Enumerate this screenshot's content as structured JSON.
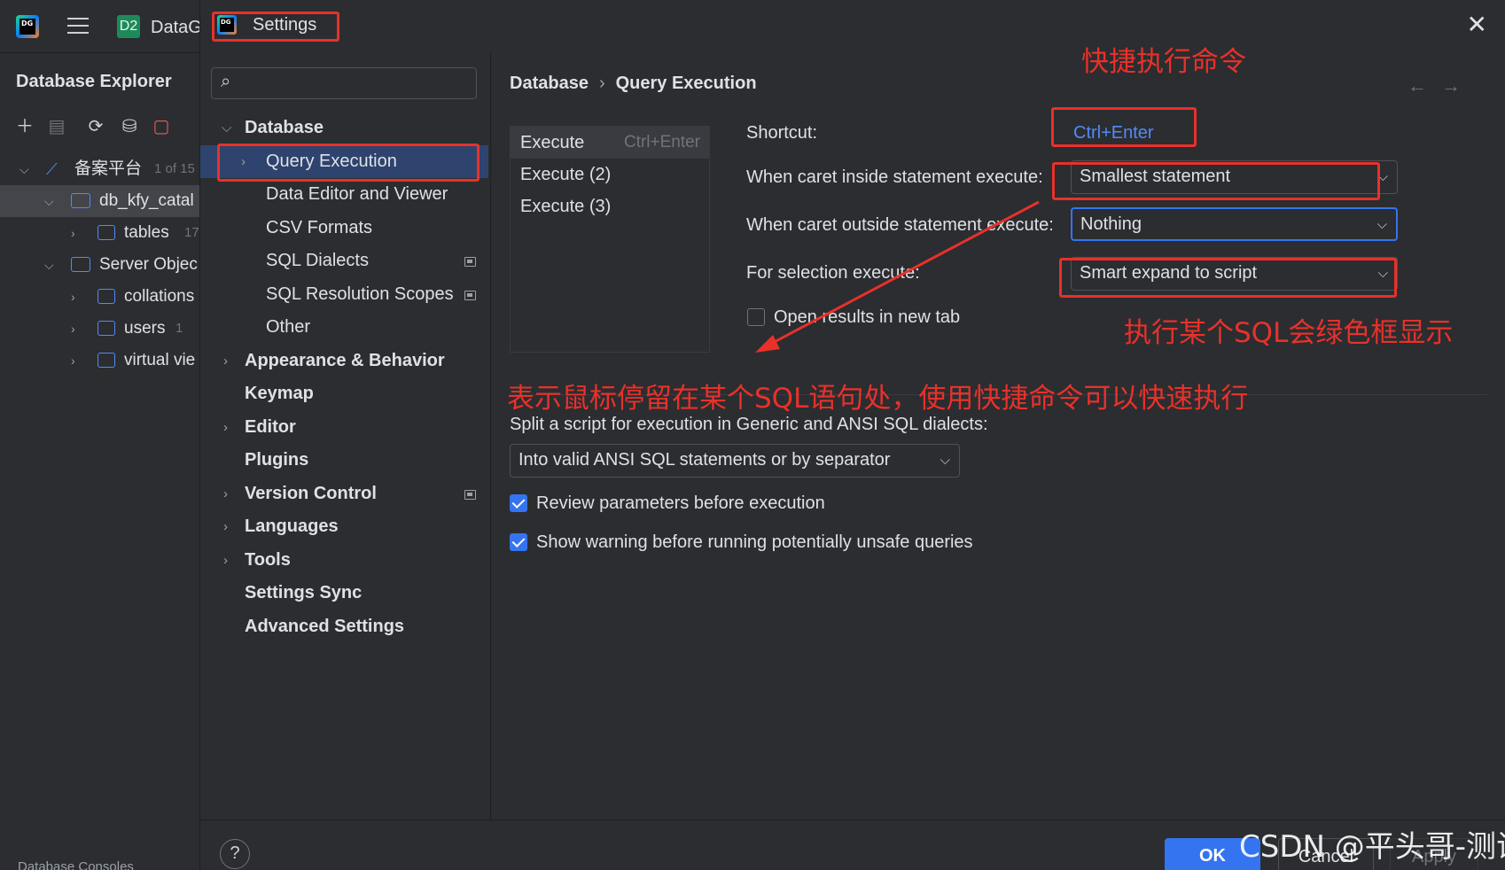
{
  "ide": {
    "logo_text": "DG",
    "project_badge": "D2",
    "project_name": "DataG",
    "explorer_title": "Database Explorer",
    "tree": [
      {
        "label": "备案平台",
        "count": "1 of 15"
      },
      {
        "label": "db_kfy_catal",
        "count": ""
      },
      {
        "label": "tables",
        "count": "17"
      },
      {
        "label": "Server Objec",
        "count": ""
      },
      {
        "label": "collations",
        "count": ""
      },
      {
        "label": "users",
        "count": "1"
      },
      {
        "label": "virtual vie",
        "count": ""
      }
    ],
    "bottom_text": "Database Consoles"
  },
  "dialog": {
    "title": "Settings",
    "logo_text": "DG",
    "close_glyph": "✕",
    "search_glyph": "⌕",
    "nav": [
      {
        "label": "Database"
      },
      {
        "label": "Query Execution"
      },
      {
        "label": "Data Editor and Viewer"
      },
      {
        "label": "CSV Formats"
      },
      {
        "label": "SQL Dialects"
      },
      {
        "label": "SQL Resolution Scopes"
      },
      {
        "label": "Other"
      },
      {
        "label": "Appearance & Behavior"
      },
      {
        "label": "Keymap"
      },
      {
        "label": "Editor"
      },
      {
        "label": "Plugins"
      },
      {
        "label": "Version Control"
      },
      {
        "label": "Languages"
      },
      {
        "label": "Tools"
      },
      {
        "label": "Settings Sync"
      },
      {
        "label": "Advanced Settings"
      }
    ],
    "breadcrumb": {
      "parent": "Database",
      "separator": "›",
      "current": "Query Execution"
    },
    "nav_arrows": "←→",
    "actions": [
      {
        "label": "Execute",
        "key": "Ctrl+Enter"
      },
      {
        "label": "Execute (2)",
        "key": ""
      },
      {
        "label": "Execute (3)",
        "key": ""
      }
    ],
    "form": {
      "shortcut_label": "Shortcut:",
      "shortcut_value": "Ctrl+Enter",
      "inside_label": "When caret inside statement execute:",
      "inside_value": "Smallest statement",
      "outside_label": "When caret outside statement execute:",
      "outside_value": "Nothing",
      "selection_label": "For selection execute:",
      "selection_value": "Smart expand to script",
      "open_results_label": "Open results in new tab",
      "split_label": "Split a script for execution in Generic and ANSI SQL dialects:",
      "split_value": "Into valid ANSI SQL statements or by separator",
      "review_label": "Review parameters before execution",
      "warning_label": "Show warning before running potentially unsafe queries",
      "dropdown_glyph": "⌵"
    },
    "buttons": {
      "help": "?",
      "ok": "OK",
      "cancel": "Cancel",
      "apply": "Apply"
    },
    "watermark": "CSDN @平头哥-测试"
  },
  "annotations": {
    "shortcut_note": "快捷执行命令",
    "green_box_note": "执行某个SQL会绿色框显示",
    "caret_note": "表示鼠标停留在某个SQL语句处，使用快捷命令可以快速执行",
    "color": "#e8312a"
  },
  "colors": {
    "background": "#2b2d30",
    "selection": "#2e436e",
    "accent": "#3574f0",
    "link": "#548af7"
  }
}
